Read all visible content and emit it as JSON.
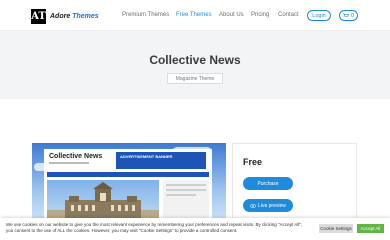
{
  "header": {
    "logo_mark": "AT",
    "logo_word1": "Adore",
    "logo_word2": "Themes",
    "nav": [
      "Premium Themes",
      "Free Themes",
      "About Us",
      "Pricing",
      "Contact"
    ],
    "active_nav": "Free Themes",
    "login_label": "Login",
    "cart_count": "0"
  },
  "hero": {
    "title": "Collective News",
    "tag": "Magazine Theme"
  },
  "preview": {
    "brand": "Collective News",
    "ad_label": "ADVERTISEMENT BANNER"
  },
  "card": {
    "price": "Free",
    "purchase_label": "Purchase",
    "preview_label": "Live preview"
  },
  "cookie": {
    "text": "We use cookies on our website to give you the most relevant experience by remembering your preferences and repeat visits. By clicking \"Accept All\", you consent to the use of ALL the cookies. However, you may visit \"Cookie Settings\" to provide a controlled consent.",
    "settings_label": "Cookie Settings",
    "accept_label": "Accept All"
  },
  "colors": {
    "accent": "#1f8bdb",
    "accept": "#62b446",
    "hero_bg": "#f3f4f6"
  }
}
